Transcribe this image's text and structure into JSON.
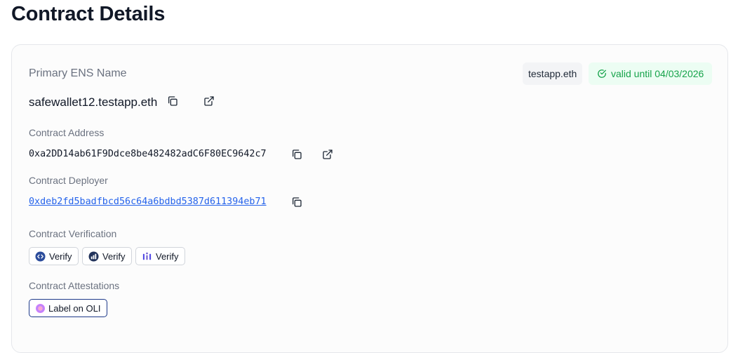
{
  "page": {
    "title": "Contract Details"
  },
  "ens": {
    "label": "Primary ENS Name",
    "name": "safewallet12.testapp.eth",
    "tag": "testapp.eth",
    "validity": "valid until 04/03/2026",
    "copy_icon": "copy-icon",
    "external_icon": "external-link-icon"
  },
  "contract_address": {
    "label": "Contract Address",
    "value": "0xa2DD14ab61F9Ddce8be482482adC6F80EC9642c7"
  },
  "contract_deployer": {
    "label": "Contract Deployer",
    "value": "0xdeb2fd5badfbcd56c64a6bdbd5387d611394eb71"
  },
  "verification": {
    "label": "Contract Verification",
    "buttons": [
      {
        "label": "Verify",
        "icon": "sourcify-icon"
      },
      {
        "label": "Verify",
        "icon": "blockscout-icon"
      },
      {
        "label": "Verify",
        "icon": "routescan-icon"
      }
    ]
  },
  "attestations": {
    "label": "Contract Attestations",
    "button_label": "Label on OLI",
    "button_icon": "oli-icon"
  },
  "colors": {
    "valid_green": "#16a34a",
    "valid_bg": "#ecfdf3",
    "link_blue": "#2563eb",
    "oli_border": "#1e3a8a"
  }
}
